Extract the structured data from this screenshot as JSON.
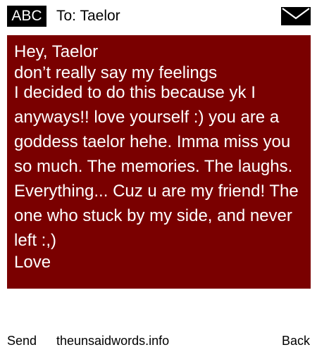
{
  "header": {
    "badge": "ABC",
    "to_line": "To: Taelor",
    "envelope_icon": "envelope-icon"
  },
  "message": {
    "greeting": "Hey, Taelor",
    "line_overlap": "don’t really say my feelings",
    "body": "I decided to do this because yk I anyways!! love yourself :) you are a goddess taelor hehe. Imma miss you so much. The memories. The laughs. Everything... Cuz u are my friend! The one who stuck by my side, and never left :,)",
    "signoff": "Love",
    "background_color": "#7a0000",
    "text_color": "#ffffff"
  },
  "footer": {
    "send": "Send",
    "site": "theunsaidwords.info",
    "back": "Back"
  }
}
